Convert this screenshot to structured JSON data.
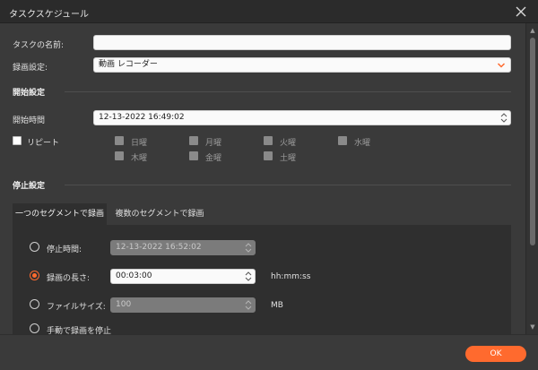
{
  "window": {
    "title": "タスクスケジュール"
  },
  "task_name": {
    "label": "タスクの名前:",
    "value": ""
  },
  "recording_setting": {
    "label": "録画設定:",
    "value": "動画 レコーダー"
  },
  "start_section": {
    "heading": "開始設定",
    "start_time_label": "開始時間",
    "start_time_value": "12-13-2022 16:49:02",
    "repeat_label": "リピート",
    "days": [
      "日曜",
      "月曜",
      "火曜",
      "水曜",
      "木曜",
      "金曜",
      "土曜"
    ]
  },
  "stop_section": {
    "heading": "停止設定",
    "tabs": [
      "一つのセグメントで録画",
      "複数のセグメントで録画"
    ],
    "options": {
      "stop_time": {
        "label": "停止時間:",
        "value": "12-13-2022 16:52:02"
      },
      "duration": {
        "label": "録画の長さ:",
        "value": "00:03:00",
        "unit": "hh:mm:ss"
      },
      "file_size": {
        "label": "ファイルサイズ:",
        "value": "100",
        "unit": "MB"
      },
      "manual": {
        "label": "手動で録画を停止"
      }
    },
    "selected_option": "duration"
  },
  "footer": {
    "ok_label": "OK"
  },
  "colors": {
    "accent": "#ff6a2e",
    "background": "#3a3a3a",
    "panel": "#2f2f2f"
  }
}
